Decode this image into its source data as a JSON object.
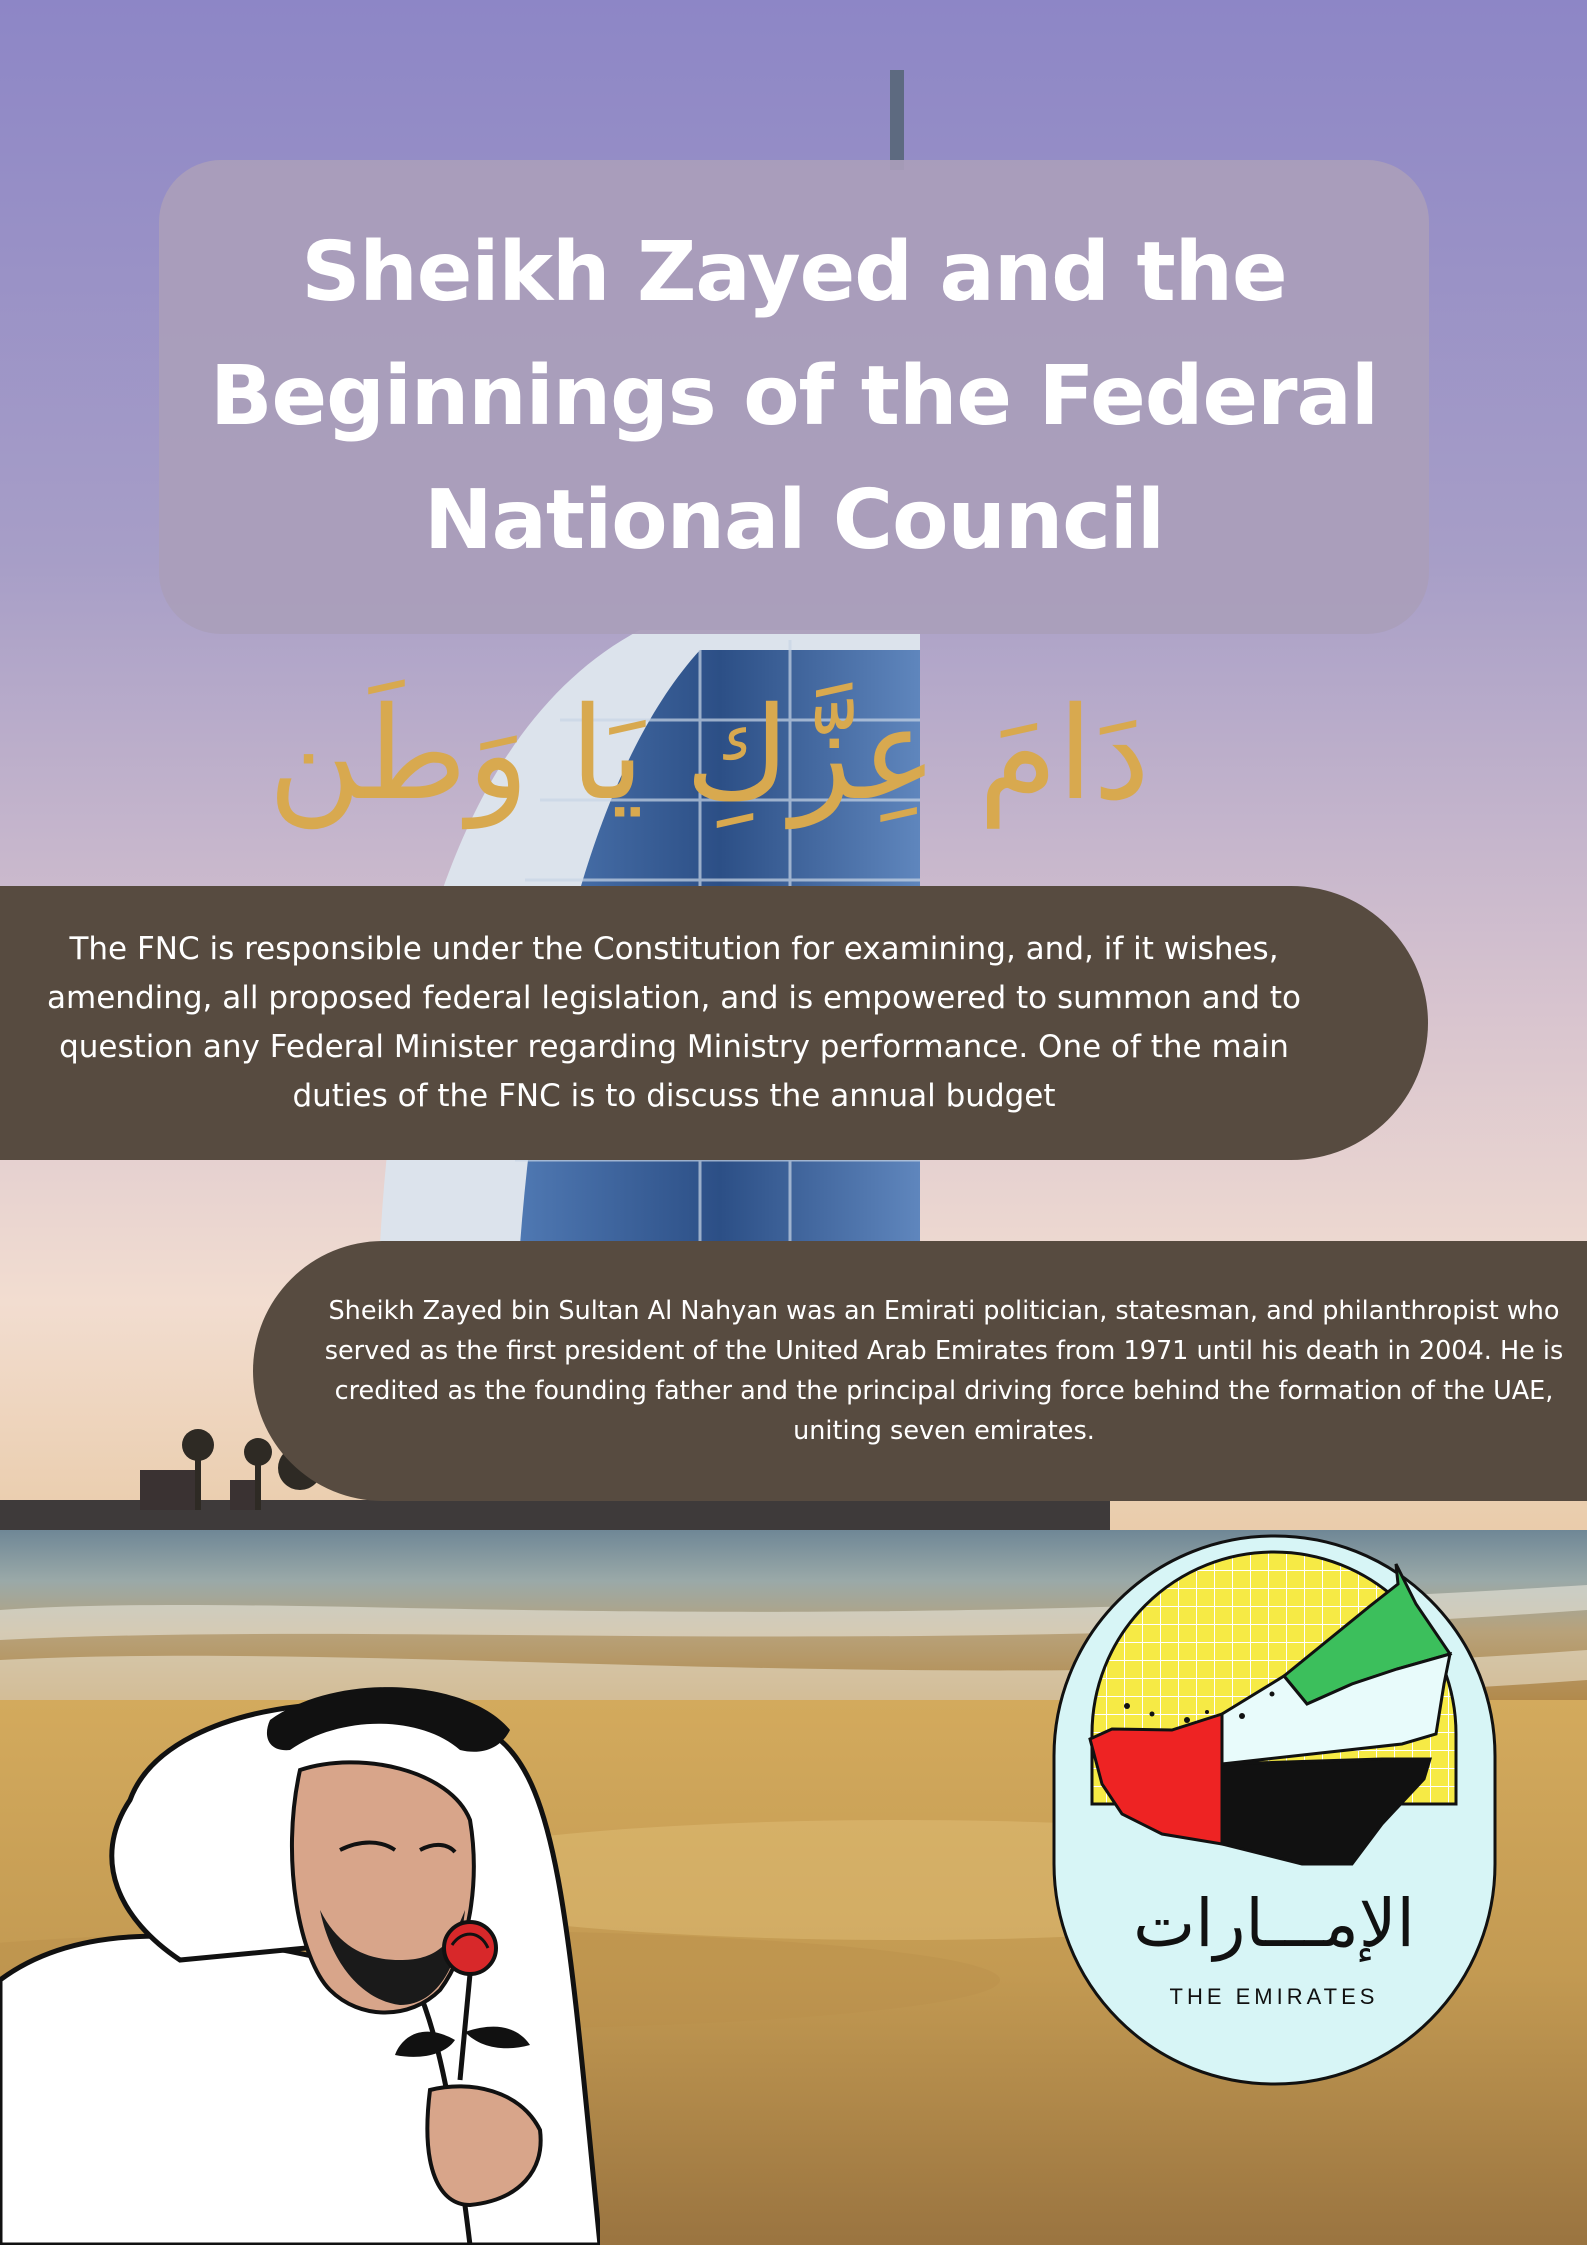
{
  "title": "Sheikh Zayed and the Beginnings of the Federal National Council",
  "calligraphy": "دَامَ عِزَّكِ يَا وَطَن",
  "fnc_paragraph": "The FNC is responsible under the Constitution for examining, and, if it wishes, amending, all proposed federal legislation, and is empowered to summon and to question any Federal Minister regarding Ministry performance. One of the main duties of the FNC is to discuss the annual budget",
  "zayed_paragraph": "Sheikh Zayed bin Sultan Al Nahyan was an Emirati politician, statesman, and philanthropist who served as the first president of the United Arab Emirates from 1971 until his death in 2004. He is credited as the founding father and the principal driving force behind the formation of the UAE, uniting seven emirates.",
  "emblem": {
    "arabic": "الإمـــارات",
    "english": "THE EMIRATES",
    "icon": "uae-map-icon"
  },
  "colors": {
    "title_box": "#aa9eba",
    "band": "#574b40",
    "calligraphy": "#d8a94f",
    "flag_red": "#ee2323",
    "flag_green": "#3cbf5c",
    "flag_black": "#111111"
  }
}
